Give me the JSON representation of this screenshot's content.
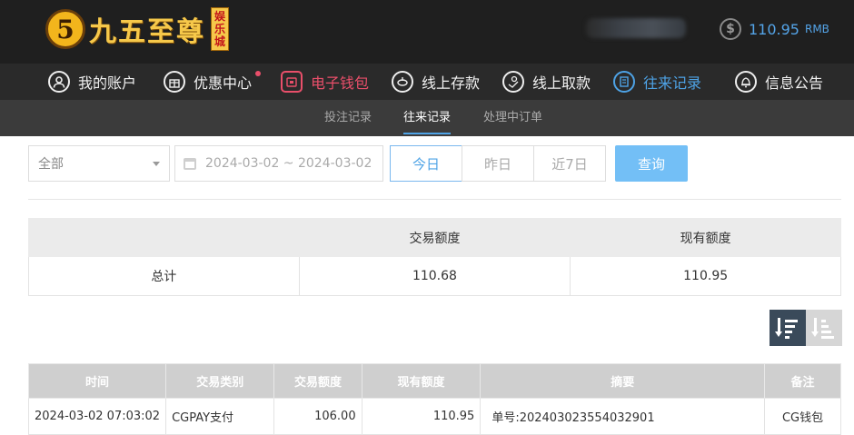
{
  "header": {
    "logo_mark": "5",
    "logo_name": "九五至尊",
    "logo_tag": [
      "娱",
      "乐",
      "城"
    ],
    "balance_value": "110.95",
    "balance_unit": "RMB"
  },
  "nav": [
    {
      "label": "我的账户",
      "icon": "user-icon"
    },
    {
      "label": "优惠中心",
      "icon": "gift-icon"
    },
    {
      "label": "电子钱包",
      "icon": "wallet-icon"
    },
    {
      "label": "线上存款",
      "icon": "deposit-icon"
    },
    {
      "label": "线上取款",
      "icon": "withdraw-icon"
    },
    {
      "label": "往来记录",
      "icon": "records-icon"
    },
    {
      "label": "信息公告",
      "icon": "bell-icon"
    }
  ],
  "subnav": [
    {
      "label": "投注记录"
    },
    {
      "label": "往来记录"
    },
    {
      "label": "处理中订单"
    }
  ],
  "filters": {
    "select_value": "全部",
    "date_range": "2024-03-02 ~ 2024-03-02",
    "quick_ranges": [
      "今日",
      "昨日",
      "近7日"
    ],
    "query_label": "查询"
  },
  "summary": {
    "headers": [
      "",
      "交易额度",
      "现有额度"
    ],
    "row": [
      "总计",
      "110.68",
      "110.95"
    ]
  },
  "records": {
    "headers": [
      "时间",
      "交易类别",
      "交易额度",
      "现有额度",
      "摘要",
      "备注"
    ],
    "rows": [
      [
        "2024-03-02 07:03:02",
        "CGPAY支付",
        "106.00",
        "110.95",
        "单号:202403023554032901",
        "CG钱包"
      ]
    ]
  },
  "colors": {
    "accent": "#4ea3e6",
    "highlight": "#e94f6a",
    "header_bg": "#1f1f1f",
    "query_button": "#73bff6"
  }
}
